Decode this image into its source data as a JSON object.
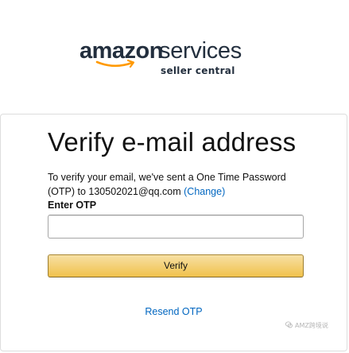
{
  "logo": {
    "amazon": "amazon",
    "services": "services",
    "tagline": "seller central",
    "smile_color": "#f90",
    "text_color": "#232f3e"
  },
  "card": {
    "title": "Verify e-mail address",
    "desc_prefix": "To verify your email, we've sent a One Time Password (OTP) to 130502021@qq.com ",
    "change_link": "(Change)",
    "otp_label": "Enter OTP",
    "otp_value": "",
    "verify_label": "Verify",
    "resend_label": "Resend OTP"
  },
  "watermark": {
    "text": "AMZ跨境说",
    "icon": "wechat-icon"
  },
  "colors": {
    "link": "#0066c0",
    "button_top": "#f7e0a4",
    "button_bottom": "#f0c14b",
    "border": "#dddddd"
  }
}
